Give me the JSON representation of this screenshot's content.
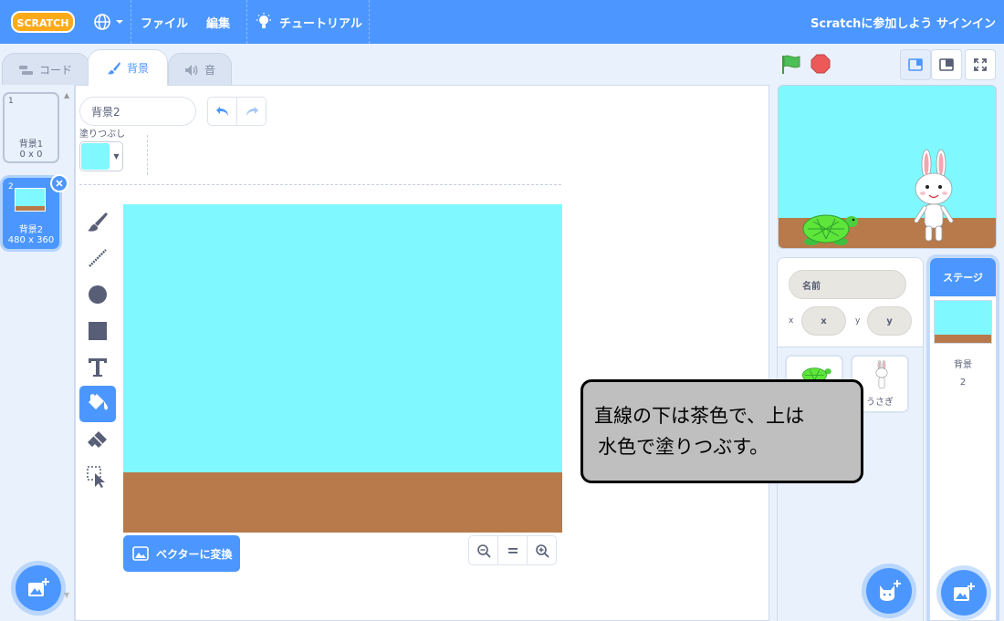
{
  "menubar": {
    "logo_text": "SCRATCH",
    "file": "ファイル",
    "edit": "編集",
    "tutorials": "チュートリアル",
    "join": "Scratchに参加しよう",
    "signin": "サインイン"
  },
  "tabs": [
    {
      "label": "コード",
      "icon": "code-blocks-icon",
      "active": false
    },
    {
      "label": "背景",
      "icon": "brush-icon",
      "active": true
    },
    {
      "label": "音",
      "icon": "speaker-icon",
      "active": false
    }
  ],
  "costumes": [
    {
      "number": "1",
      "name": "背景1",
      "size": "0 x 0",
      "selected": false
    },
    {
      "number": "2",
      "name": "背景2",
      "size": "480 x 360",
      "selected": true
    }
  ],
  "editor": {
    "costume_name": "背景2",
    "fill_label": "塗りつぶし",
    "fill_color": "#80f8ff",
    "convert_button": "ベクターに変換",
    "tools": [
      "brush-icon",
      "line-icon",
      "circle-icon",
      "rectangle-icon",
      "text-icon",
      "fill-icon",
      "eraser-icon",
      "select-icon"
    ],
    "selected_tool": "fill-icon",
    "canvas": {
      "sky_color": "#80f8ff",
      "ground_color": "#b87a4a"
    }
  },
  "callout": {
    "line1": "直線の下は茶色で、上は",
    "line2": "水色で塗りつぶす。"
  },
  "sprite_info": {
    "name_placeholder": "名前",
    "x_label": "x",
    "x_placeholder": "x",
    "y_label": "y",
    "y_placeholder": "y"
  },
  "sprites": [
    {
      "name": "",
      "icon": "turtle-icon"
    },
    {
      "name": "うさぎ",
      "icon": "rabbit-icon"
    }
  ],
  "stage_pane": {
    "header": "ステージ",
    "backdrop_label": "背景",
    "backdrop_count": "2"
  },
  "colors": {
    "accent": "#4c97ff",
    "sky": "#80f8ff",
    "ground": "#b87a4a",
    "flag": "#4cbf56",
    "stop": "#ec5959"
  }
}
